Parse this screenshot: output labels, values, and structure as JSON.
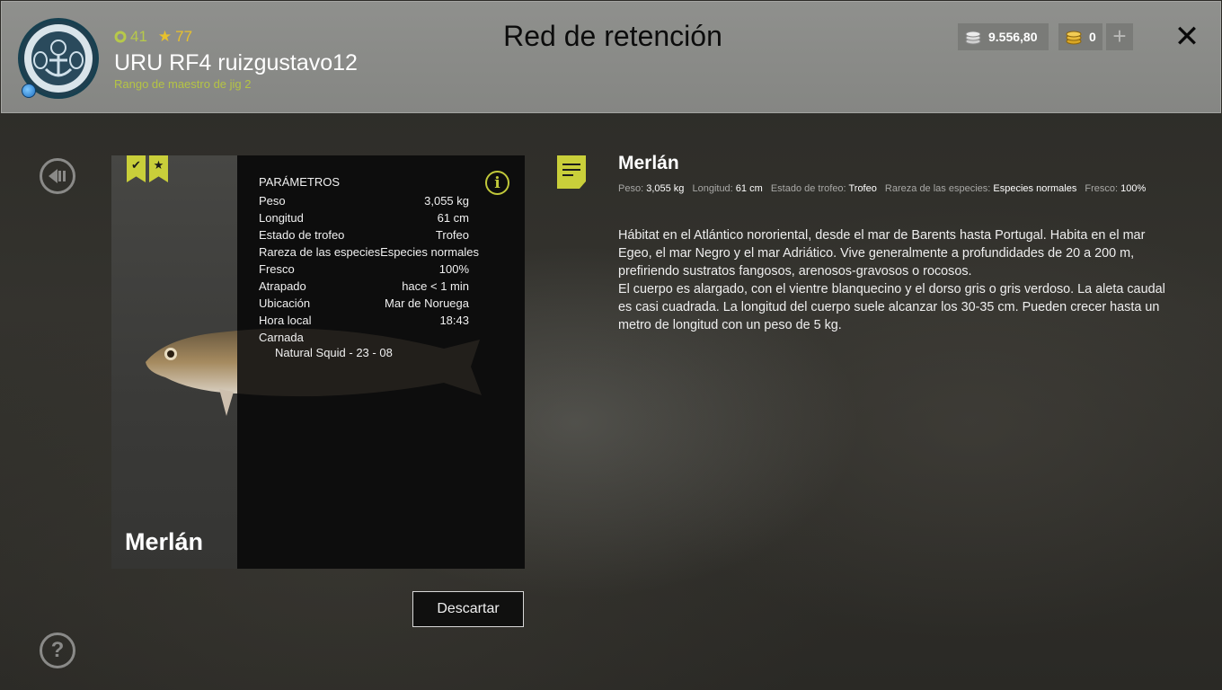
{
  "header": {
    "title": "Red de retención",
    "player": {
      "experience": "41",
      "stars": "77",
      "name": "URU RF4 ruizgustavo12",
      "rank": "Rango de maestro de jig 2"
    },
    "currency": {
      "silver": "9.556,80",
      "gold": "0"
    }
  },
  "card": {
    "fish_name": "Merlán",
    "params_title": "PARÁMETROS",
    "params": [
      {
        "label": "Peso",
        "value": "3,055 kg"
      },
      {
        "label": "Longitud",
        "value": "61 cm"
      },
      {
        "label": "Estado de trofeo",
        "value": "Trofeo"
      },
      {
        "label": "Rareza de las especies",
        "value": "Especies normales"
      },
      {
        "label": "Fresco",
        "value": "100%"
      },
      {
        "label": "Atrapado",
        "value": "hace < 1 min"
      },
      {
        "label": "Ubicación",
        "value": "Mar de Noruega"
      },
      {
        "label": "Hora local",
        "value": "18:43"
      }
    ],
    "bait_label": "Carnada",
    "bait_value": "Natural Squid - 23 - 08"
  },
  "actions": {
    "discard": "Descartar"
  },
  "description": {
    "title": "Merlán",
    "meta": [
      {
        "label": "Peso:",
        "value": "3,055 kg"
      },
      {
        "label": "Longitud:",
        "value": "61 cm"
      },
      {
        "label": "Estado de trofeo:",
        "value": "Trofeo"
      },
      {
        "label": "Rareza de las especies:",
        "value": "Especies normales"
      },
      {
        "label": "Fresco:",
        "value": "100%"
      }
    ],
    "paragraph1": "Hábitat en el Atlántico nororiental, desde el mar de Barents hasta Portugal. Habita en el mar Egeo, el mar Negro y el mar Adriático. Vive generalmente a profundidades de 20 a 200 m, prefiriendo sustratos fangosos, arenosos-gravosos o rocosos.",
    "paragraph2": "El cuerpo es alargado, con el vientre blanquecino y el dorso gris o gris verdoso. La aleta caudal es casi cuadrada. La longitud del cuerpo suele alcanzar los 30-35 cm. Pueden crecer hasta un metro de longitud con un peso de 5 kg."
  },
  "colors": {
    "accent": "#c9cf3a",
    "header_bg": "#8a8b88",
    "rank_text": "#b5c444"
  }
}
